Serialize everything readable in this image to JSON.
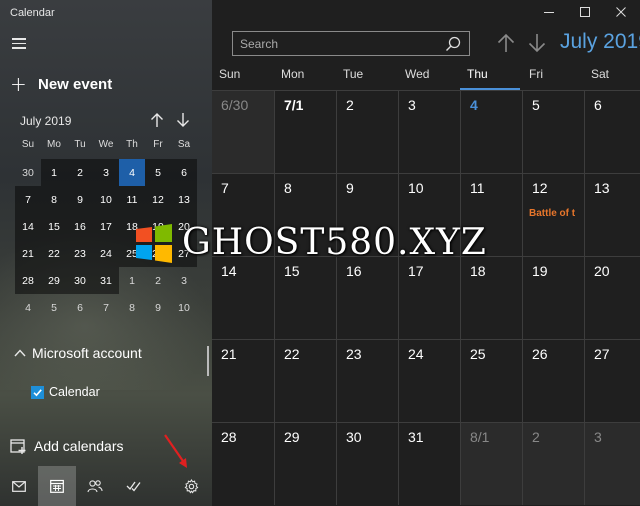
{
  "app": {
    "title": "Calendar"
  },
  "sidebar": {
    "new_event_label": "New event",
    "mini_calendar": {
      "month_label": "July 2019",
      "days_of_week": [
        "Su",
        "Mo",
        "Tu",
        "We",
        "Th",
        "Fr",
        "Sa"
      ],
      "weeks": [
        [
          "30",
          "1",
          "2",
          "3",
          "4",
          "5",
          "6"
        ],
        [
          "7",
          "8",
          "9",
          "10",
          "11",
          "12",
          "13"
        ],
        [
          "14",
          "15",
          "16",
          "17",
          "18",
          "19",
          "20"
        ],
        [
          "21",
          "22",
          "23",
          "24",
          "25",
          "26",
          "27"
        ],
        [
          "28",
          "29",
          "30",
          "31",
          "1",
          "2",
          "3"
        ],
        [
          "4",
          "5",
          "6",
          "7",
          "8",
          "9",
          "10"
        ]
      ],
      "selected_day": "4"
    },
    "account_label": "Microsoft account",
    "calendar_item_label": "Calendar",
    "calendar_item_checked": true,
    "add_calendars_label": "Add calendars",
    "bottom_icons": [
      "mail-icon",
      "calendar-icon",
      "people-icon",
      "todo-icon",
      "settings-icon"
    ]
  },
  "main": {
    "search_placeholder": "Search",
    "month_title": "July 2019",
    "days_of_week": [
      "Sun",
      "Mon",
      "Tue",
      "Wed",
      "Thu",
      "Fri",
      "Sat"
    ],
    "today_column": "Thu",
    "weeks": [
      [
        "6/30",
        "7/1",
        "2",
        "3",
        "4",
        "5",
        "6"
      ],
      [
        "7",
        "8",
        "9",
        "10",
        "11",
        "12",
        "13"
      ],
      [
        "14",
        "15",
        "16",
        "17",
        "18",
        "19",
        "20"
      ],
      [
        "21",
        "22",
        "23",
        "24",
        "25",
        "26",
        "27"
      ],
      [
        "28",
        "29",
        "30",
        "31",
        "8/1",
        "2",
        "3"
      ]
    ],
    "event": {
      "day": "12",
      "title": "Battle of t",
      "color": "#e8762b"
    }
  },
  "watermark": {
    "text": "GHOST580.XYZ"
  },
  "colors": {
    "accent": "#4a90d9",
    "today_fill": "#1e5fa8",
    "event": "#e8762b"
  }
}
